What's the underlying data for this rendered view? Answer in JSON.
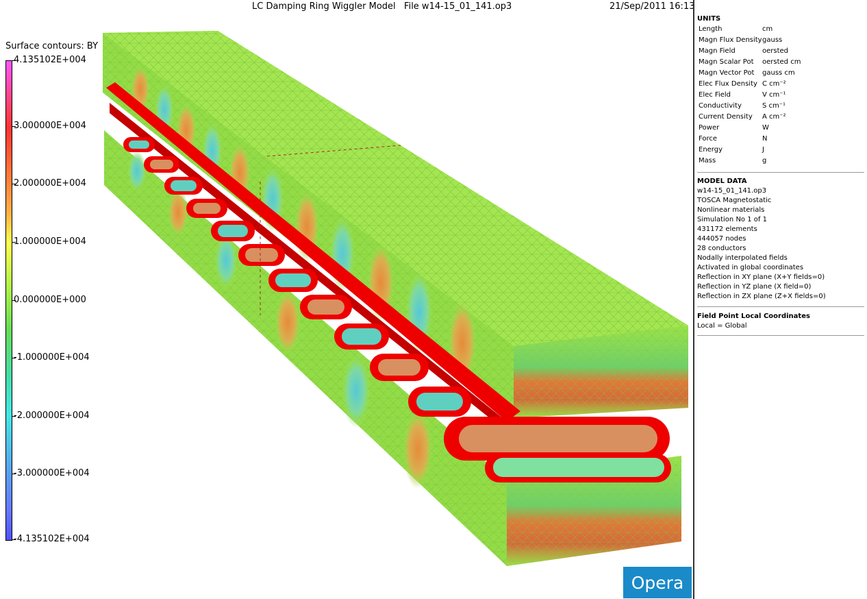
{
  "header": {
    "title": "LC Damping Ring Wiggler Model   File w14-15_01_141.op3",
    "datetime": "21/Sep/2011 16:13:"
  },
  "legend": {
    "title": "Surface contours: BY",
    "ticks": [
      {
        "label": "4.135102E+004",
        "value": 41351.02
      },
      {
        "label": "3.000000E+004",
        "value": 30000
      },
      {
        "label": "2.000000E+004",
        "value": 20000
      },
      {
        "label": "1.000000E+004",
        "value": 10000
      },
      {
        "label": "0.000000E+000",
        "value": 0
      },
      {
        "label": "-1.000000E+004",
        "value": -10000
      },
      {
        "label": "-2.000000E+004",
        "value": -20000
      },
      {
        "label": "-3.000000E+004",
        "value": -30000
      },
      {
        "label": "-4.135102E+004",
        "value": -41351.02
      }
    ]
  },
  "units": {
    "heading": "UNITS",
    "rows": [
      {
        "name": "Length",
        "unit": "cm"
      },
      {
        "name": "Magn Flux Density",
        "unit": "gauss"
      },
      {
        "name": "Magn Field",
        "unit": "oersted"
      },
      {
        "name": "Magn Scalar Pot",
        "unit": "oersted cm"
      },
      {
        "name": "Magn Vector Pot",
        "unit": "gauss cm"
      },
      {
        "name": "Elec Flux Density",
        "unit": "C cm⁻²"
      },
      {
        "name": "Elec Field",
        "unit": "V cm⁻¹"
      },
      {
        "name": "Conductivity",
        "unit": "S cm⁻¹"
      },
      {
        "name": "Current Density",
        "unit": "A cm⁻²"
      },
      {
        "name": "Power",
        "unit": "W"
      },
      {
        "name": "Force",
        "unit": "N"
      },
      {
        "name": "Energy",
        "unit": "J"
      },
      {
        "name": "Mass",
        "unit": "g"
      }
    ]
  },
  "model_data": {
    "heading": "MODEL DATA",
    "lines": [
      "w14-15_01_141.op3",
      "TOSCA Magnetostatic",
      "Nonlinear materials",
      "Simulation No 1 of 1",
      "431172 elements",
      "444057 nodes",
      "28 conductors",
      "Nodally interpolated fields",
      "Activated in global coordinates",
      "Reflection in XY plane (X+Y fields=0)",
      "Reflection in YZ plane (X field=0)",
      "Reflection in ZX plane (Z+X fields=0)"
    ]
  },
  "field_point": {
    "heading": "Field Point Local Coordinates",
    "line": "Local = Global"
  },
  "brand": {
    "label": "Opera"
  },
  "colors": {
    "mesh_green": "#9be24a",
    "coil_red": "#ee0000",
    "brand_blue": "#1a8ac9"
  }
}
